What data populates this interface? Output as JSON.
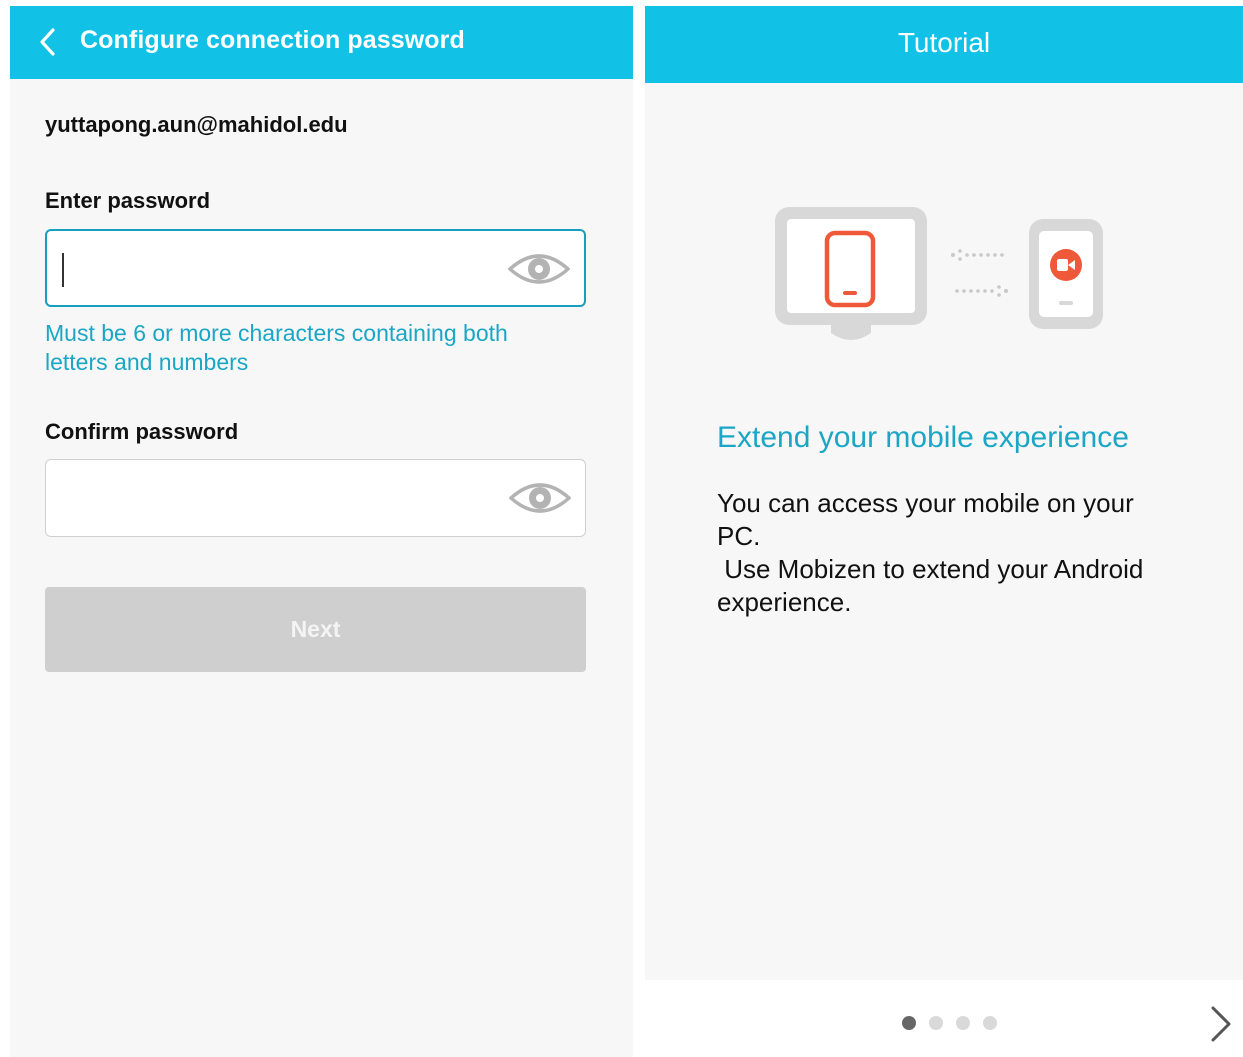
{
  "left_screen": {
    "appbar": {
      "back_icon": "chevron-left-icon",
      "title": "Configure connection password"
    },
    "email": "yuttapong.aun@mahidol.edu",
    "password": {
      "label": "Enter password",
      "value": "",
      "visibility_icon": "eye-icon"
    },
    "hint": "Must be 6 or more characters containing both letters and numbers",
    "confirm": {
      "label": "Confirm password",
      "value": "",
      "visibility_icon": "eye-icon"
    },
    "next_button": {
      "label": "Next",
      "enabled": false
    }
  },
  "right_screen": {
    "appbar": {
      "title": "Tutorial"
    },
    "illustration_icon": "pc-mirroring-phone-icon",
    "heading": "Extend your mobile experience",
    "body_lines": [
      "You can access your mobile on your",
      "PC.",
      " Use Mobizen to extend your Android",
      "experience."
    ],
    "pager": {
      "total": 4,
      "current": 1
    },
    "next_icon": "chevron-right-icon"
  },
  "colors": {
    "appbar": "#12c1e6",
    "accent_text": "#1ba6c6",
    "focus_border": "#159fc0",
    "disabled_button": "#cfcfcf",
    "illustration_red": "#f0583a"
  }
}
